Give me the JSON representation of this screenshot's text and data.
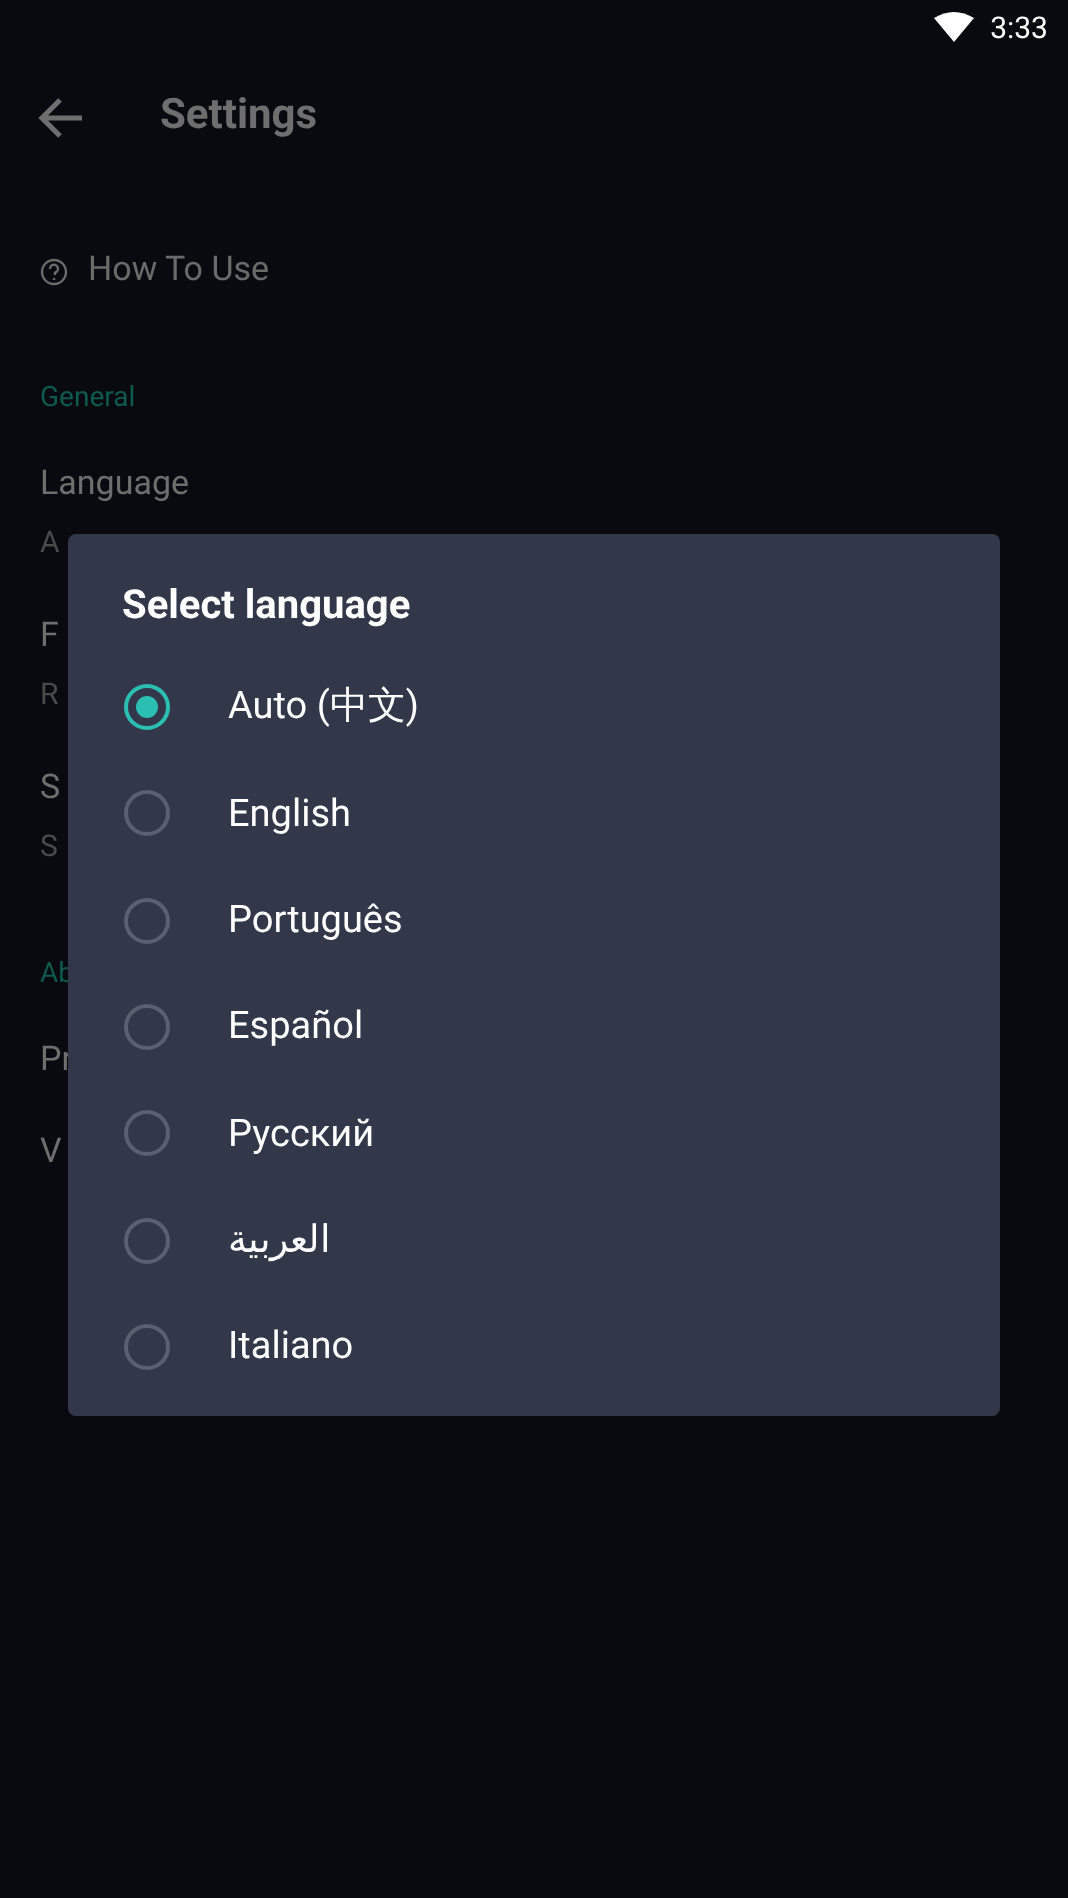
{
  "status_bar": {
    "time": "3:33"
  },
  "app_bar": {
    "title": "Settings"
  },
  "how_to_use": {
    "label": "How To Use"
  },
  "sections": [
    {
      "header": "General",
      "items": [
        {
          "title": "Language",
          "subtitle": "A"
        },
        {
          "title": "F",
          "subtitle": "R"
        },
        {
          "title": "S",
          "subtitle": "S"
        }
      ]
    },
    {
      "header": "Ab",
      "items": [
        {
          "title": "Pr"
        },
        {
          "title": "V"
        }
      ]
    }
  ],
  "dialog": {
    "title": "Select language",
    "options": [
      {
        "label": "Auto (中文)",
        "selected": true
      },
      {
        "label": "English",
        "selected": false
      },
      {
        "label": "Português",
        "selected": false
      },
      {
        "label": "Español",
        "selected": false
      },
      {
        "label": "Русский",
        "selected": false
      },
      {
        "label": "العربية",
        "selected": false
      },
      {
        "label": "Italiano",
        "selected": false
      }
    ]
  }
}
